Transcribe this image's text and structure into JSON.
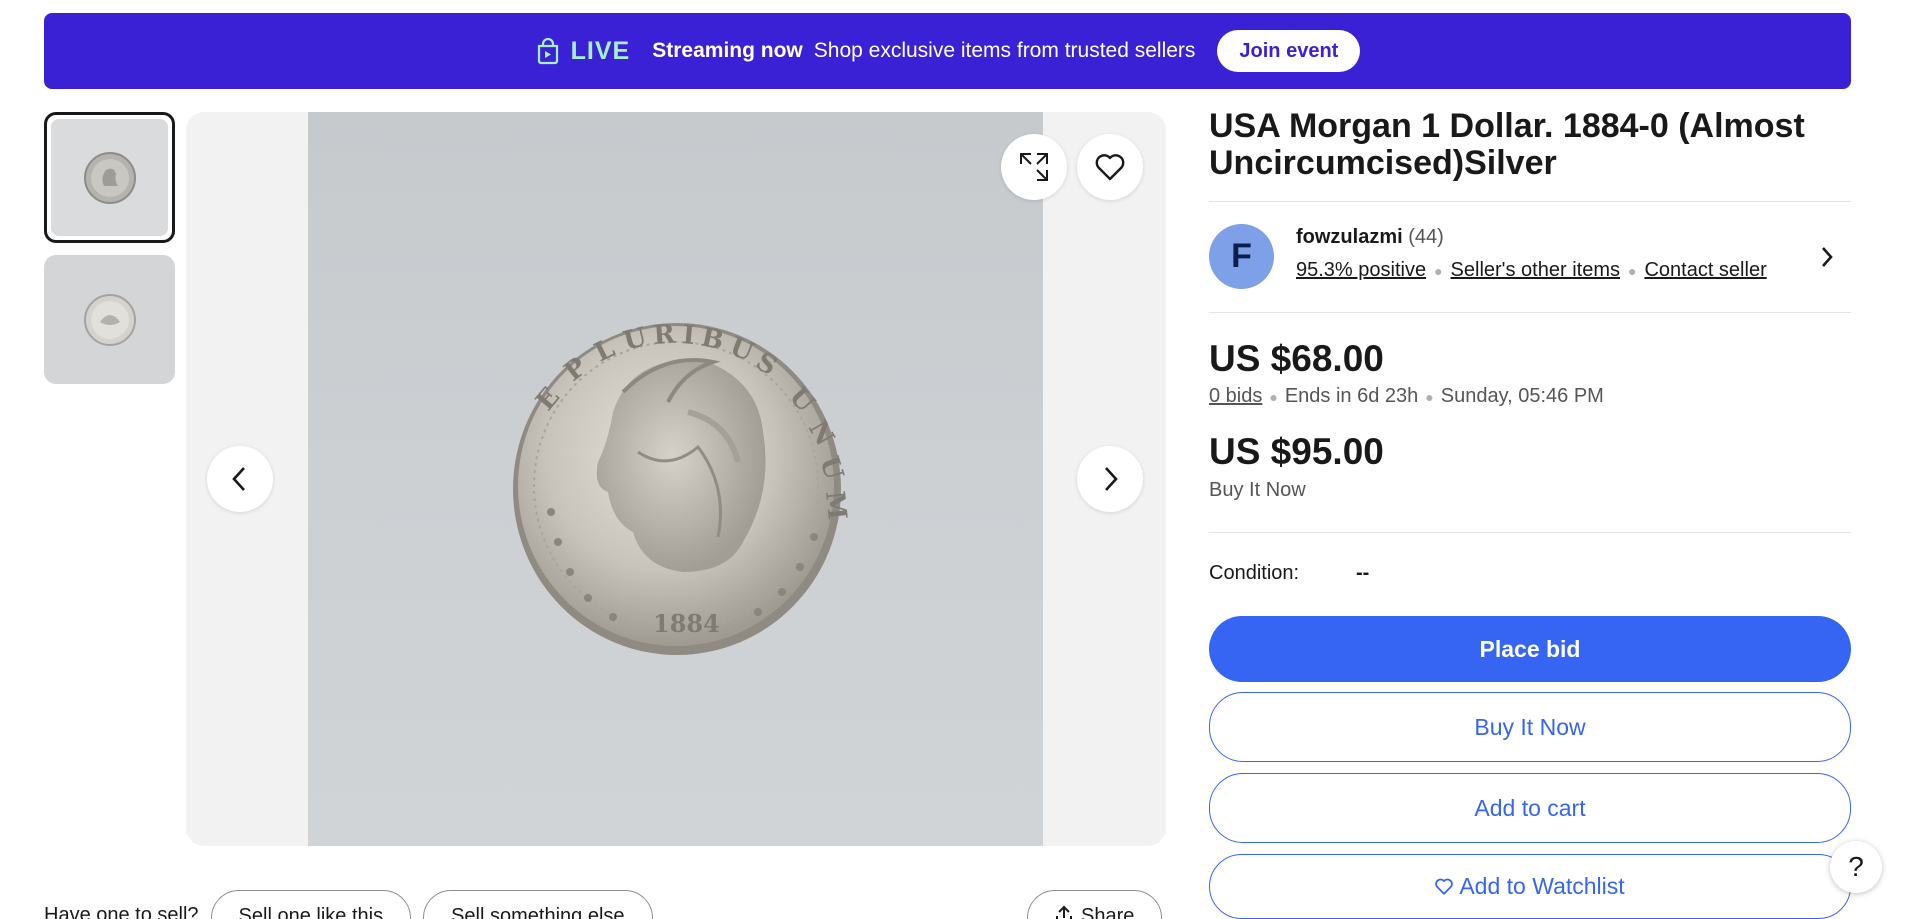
{
  "banner": {
    "live_label": "LIVE",
    "streaming_label": "Streaming now",
    "message": "Shop exclusive items from trusted sellers",
    "join_button": "Join event",
    "background_color": "#3b21d6",
    "live_color": "#a6f0c6",
    "icon": "shopping-bag-icon"
  },
  "gallery": {
    "thumbnails": [
      {
        "selected": true
      },
      {
        "selected": false
      }
    ],
    "icons": [
      "expand-icon",
      "heart-icon",
      "chevron-left-icon",
      "chevron-right-icon"
    ]
  },
  "sell": {
    "question": "Have one to sell?",
    "sell_like_button": "Sell one like this",
    "sell_else_button": "Sell something else",
    "share_button": "Share"
  },
  "listing": {
    "title": "USA Morgan 1 Dollar. 1884-0 (Almost Uncircumcised)Silver",
    "seller": {
      "initial": "F",
      "name": "fowzulazmi",
      "feedback_count": "(44)",
      "positive": "95.3% positive",
      "other_items": "Seller's other items",
      "contact": "Contact seller"
    },
    "auction_price": "US $68.00",
    "bids": "0 bids",
    "ends_in": "Ends in 6d 23h",
    "end_time": "Sunday, 05:46 PM",
    "bin_price": "US $95.00",
    "bin_label": "Buy It Now",
    "condition_label": "Condition:",
    "condition_value": "--",
    "buttons": {
      "place_bid": "Place bid",
      "buy_it_now": "Buy It Now",
      "add_to_cart": "Add to cart",
      "add_to_watchlist": "Add to Watchlist"
    },
    "accent_color": "#3665f3"
  },
  "help": {
    "label": "?"
  }
}
